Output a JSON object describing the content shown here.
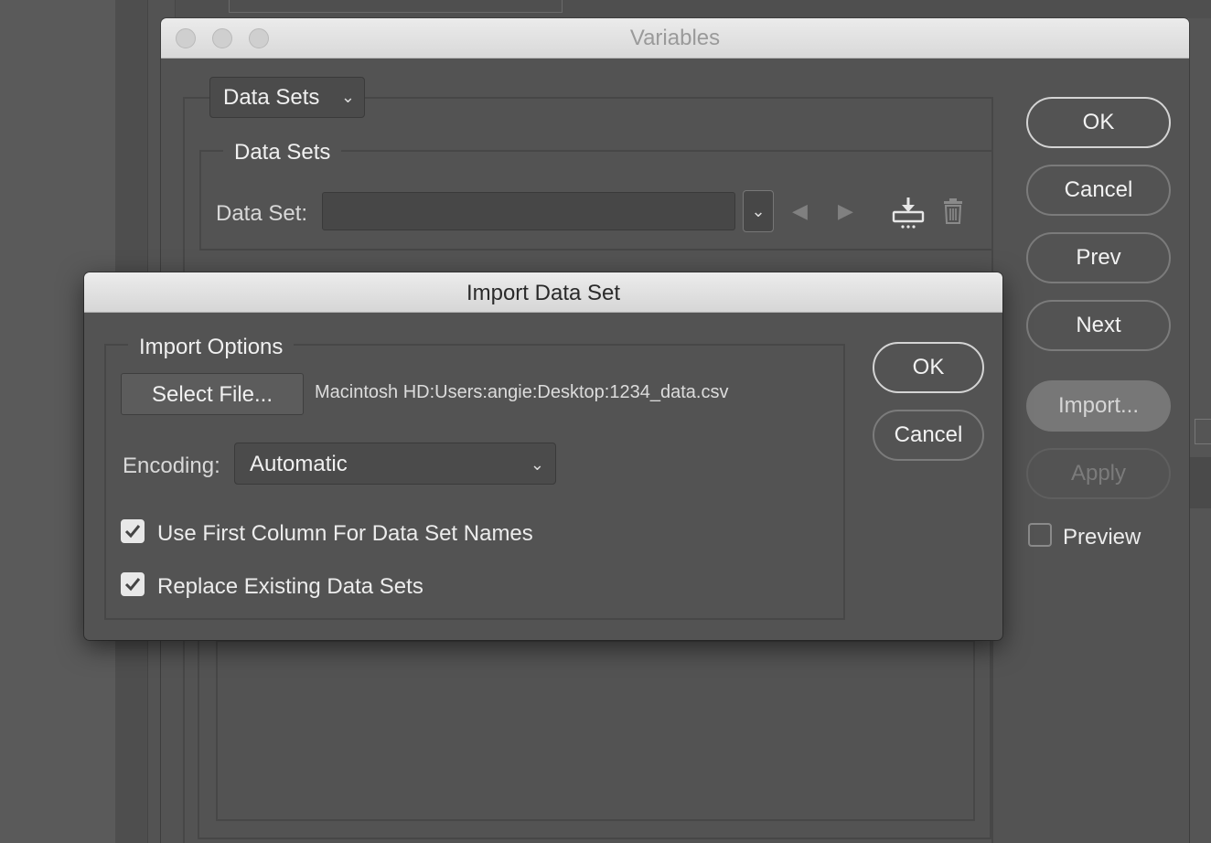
{
  "variables_window": {
    "title": "Variables",
    "panel_dropdown": {
      "selected": "Data Sets"
    },
    "data_sets_group": {
      "label": "Data Sets",
      "data_set_label": "Data Set:",
      "data_set_value": ""
    },
    "buttons": {
      "ok": "OK",
      "cancel": "Cancel",
      "prev": "Prev",
      "next": "Next",
      "import": "Import...",
      "apply": "Apply"
    },
    "preview": {
      "label": "Preview",
      "checked": false
    }
  },
  "import_dialog": {
    "title": "Import Data Set",
    "group_label": "Import Options",
    "select_file_label": "Select File...",
    "file_path": "Macintosh HD:Users:angie:Desktop:1234_data.csv",
    "encoding_label": "Encoding:",
    "encoding_value": "Automatic",
    "checkboxes": [
      {
        "label": "Use First Column For Data Set Names",
        "checked": true
      },
      {
        "label": "Replace Existing Data Sets",
        "checked": true
      }
    ],
    "ok_label": "OK",
    "cancel_label": "Cancel"
  },
  "icons": {
    "dropdown": "chevron-down-icon",
    "prev": "triangle-left-icon",
    "next": "triangle-right-icon",
    "import_data": "import-icon",
    "delete": "trash-icon",
    "check": "checkmark-icon"
  },
  "colors": {
    "panel_bg": "#535353",
    "titlebar_bg": "#e0e0e0",
    "text": "#ececec",
    "disabled_text": "#7b7b7b"
  }
}
